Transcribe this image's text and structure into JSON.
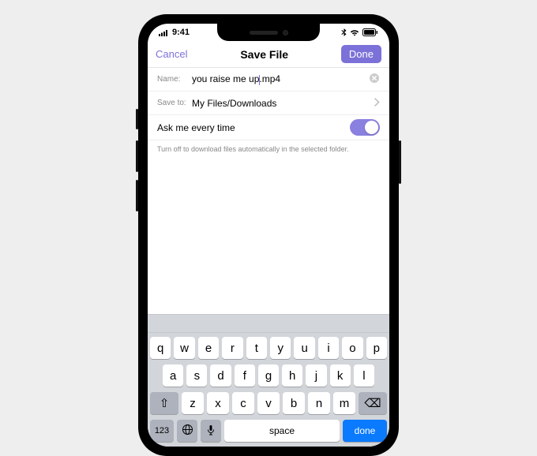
{
  "statusbar": {
    "time": "9:41"
  },
  "nav": {
    "cancel": "Cancel",
    "title": "Save File",
    "done": "Done"
  },
  "nameRow": {
    "label": "Name:",
    "value_pre": "you raise me up",
    "value_post": ".mp4"
  },
  "saveToRow": {
    "label": "Save to:",
    "value": "My Files/Downloads"
  },
  "toggleRow": {
    "label": "Ask me every time",
    "on": true
  },
  "hint": "Turn off to download files automatically in the selected folder.",
  "keyboard": {
    "row1": [
      "q",
      "w",
      "e",
      "r",
      "t",
      "y",
      "u",
      "i",
      "o",
      "p"
    ],
    "row2": [
      "a",
      "s",
      "d",
      "f",
      "g",
      "h",
      "j",
      "k",
      "l"
    ],
    "row3": [
      "z",
      "x",
      "c",
      "v",
      "b",
      "n",
      "m"
    ],
    "shift": "⇧",
    "backspace": "⌫",
    "numbers": "123",
    "globe": "🌐",
    "mic": "🎤",
    "space": "space",
    "done": "done"
  }
}
